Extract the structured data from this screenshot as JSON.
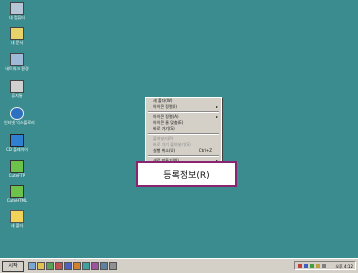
{
  "desktop": {
    "icons": [
      {
        "label": "내 컴퓨터",
        "icon": "computer-icon"
      },
      {
        "label": "내 문서",
        "icon": "folder-icon"
      },
      {
        "label": "네트워크 환경",
        "icon": "network-icon"
      },
      {
        "label": "휴지통",
        "icon": "recycle-bin-icon"
      },
      {
        "label": "인터넷 익스플로러",
        "icon": "internet-explorer-icon"
      },
      {
        "label": "CD 플레이어",
        "icon": "app-icon"
      },
      {
        "label": "CuteFTP",
        "icon": "ftp-icon"
      },
      {
        "label": "CuteHTML",
        "icon": "html-icon"
      },
      {
        "label": "새 폴더",
        "icon": "folder-icon"
      }
    ],
    "background_color": "#3a8c8e"
  },
  "context_menu": {
    "items": [
      {
        "label": "새 폴더(W)",
        "disabled": false,
        "submenu": false
      },
      {
        "label": "아이콘 정렬(I)",
        "disabled": false,
        "submenu": true
      },
      {
        "label": "",
        "separator": true
      },
      {
        "label": "아이콘 정렬(A)",
        "disabled": false,
        "submenu": true
      },
      {
        "label": "아이콘 줄 맞춤(E)",
        "disabled": false,
        "submenu": false
      },
      {
        "label": "바로 가기(S)",
        "disabled": false,
        "submenu": false
      },
      {
        "label": "",
        "separator": true
      },
      {
        "label": "붙여넣기(P)",
        "disabled": true,
        "submenu": false
      },
      {
        "label": "바로 가기 붙여넣기(S)",
        "disabled": true,
        "submenu": false
      },
      {
        "label": "실행 취소(U)",
        "disabled": false,
        "submenu": false,
        "shortcut": "Ctrl+Z"
      },
      {
        "label": "",
        "separator": true
      },
      {
        "label": "새로 만들기(N)",
        "disabled": false,
        "submenu": true
      }
    ]
  },
  "highlight": {
    "label": "등록정보(R)",
    "border_color": "#8a2470"
  },
  "taskbar": {
    "start_label": "시작",
    "clock": "오후 4:12"
  }
}
